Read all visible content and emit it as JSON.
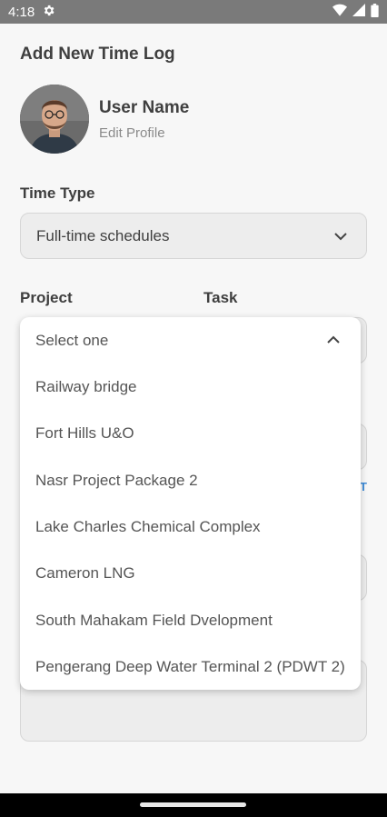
{
  "status_bar": {
    "time": "4:18"
  },
  "page": {
    "title": "Add New Time Log"
  },
  "profile": {
    "name": "User Name",
    "edit_label": "Edit Profile"
  },
  "time_type": {
    "label": "Time Type",
    "value": "Full-time schedules"
  },
  "project": {
    "label": "Project"
  },
  "task": {
    "label": "Task"
  },
  "stub_link": "T",
  "dropdown": {
    "selected": "Select one",
    "options": [
      "Railway bridge",
      "Fort Hills U&O",
      "Nasr Project Package 2",
      "Lake Charles Chemical Complex",
      "Cameron LNG",
      "South Mahakam Field Dvelopment",
      "Pengerang Deep Water Terminal 2 (PDWT 2)"
    ]
  },
  "colors": {
    "accent": "#3d8bd8",
    "status_bar": "#7a7a7a",
    "background": "#f7f7f7"
  }
}
